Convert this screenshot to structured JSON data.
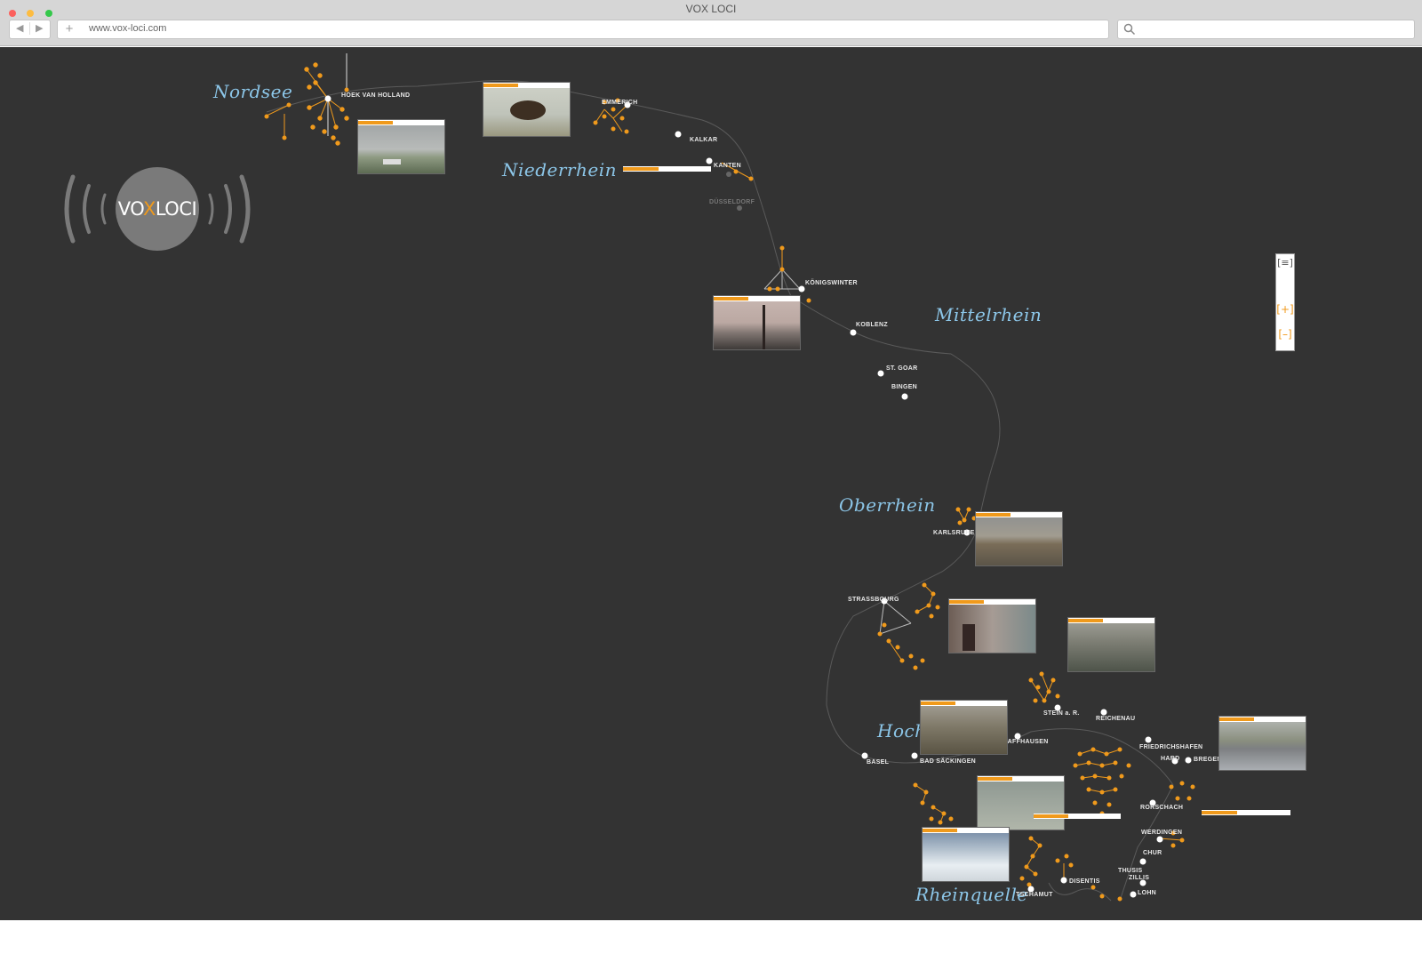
{
  "window": {
    "title": "VOX LOCI",
    "url": "www.vox-loci.com"
  },
  "logo": {
    "text_left": "VO",
    "text_mid": "X",
    "text_right": "LOCI"
  },
  "regions": [
    {
      "id": "nordsee",
      "label": "Nordsee"
    },
    {
      "id": "niederrhein",
      "label": "Niederrhein"
    },
    {
      "id": "mittelrhein",
      "label": "Mittelrhein"
    },
    {
      "id": "oberrhein",
      "label": "Oberrhein"
    },
    {
      "id": "hoch",
      "label": "Hoch"
    },
    {
      "id": "rheinquelle",
      "label": "Rheinquelle"
    }
  ],
  "cities": [
    "HOEK VAN HOLLAND",
    "EMMERICH",
    "KALKAR",
    "KANTEN",
    "DÜSSELDORF",
    "KÖNIGSWINTER",
    "KOBLENZ",
    "ST. GOAR",
    "BINGEN",
    "KARLSRUHE",
    "STRASSBOURG",
    "STEIN a. R.",
    "REICHENAU",
    "SCHAFFHAUSEN",
    "BASEL",
    "BAD SÄCKINGEN",
    "FRIEDRICHSHAFEN",
    "HARD",
    "BREGENZ",
    "RORSCHACH",
    "WERDINGEN",
    "CHUR",
    "THUSIS",
    "ZILLIS",
    "LOHN",
    "DISENTIS",
    "TSCHAMUT"
  ],
  "zoom": {
    "fit": "[≡]",
    "in": "[+]",
    "out": "[–]"
  },
  "colors": {
    "background": "#333333",
    "accent": "#f09a1c",
    "region_text": "#8cc6e8",
    "node": "#ffffff"
  }
}
